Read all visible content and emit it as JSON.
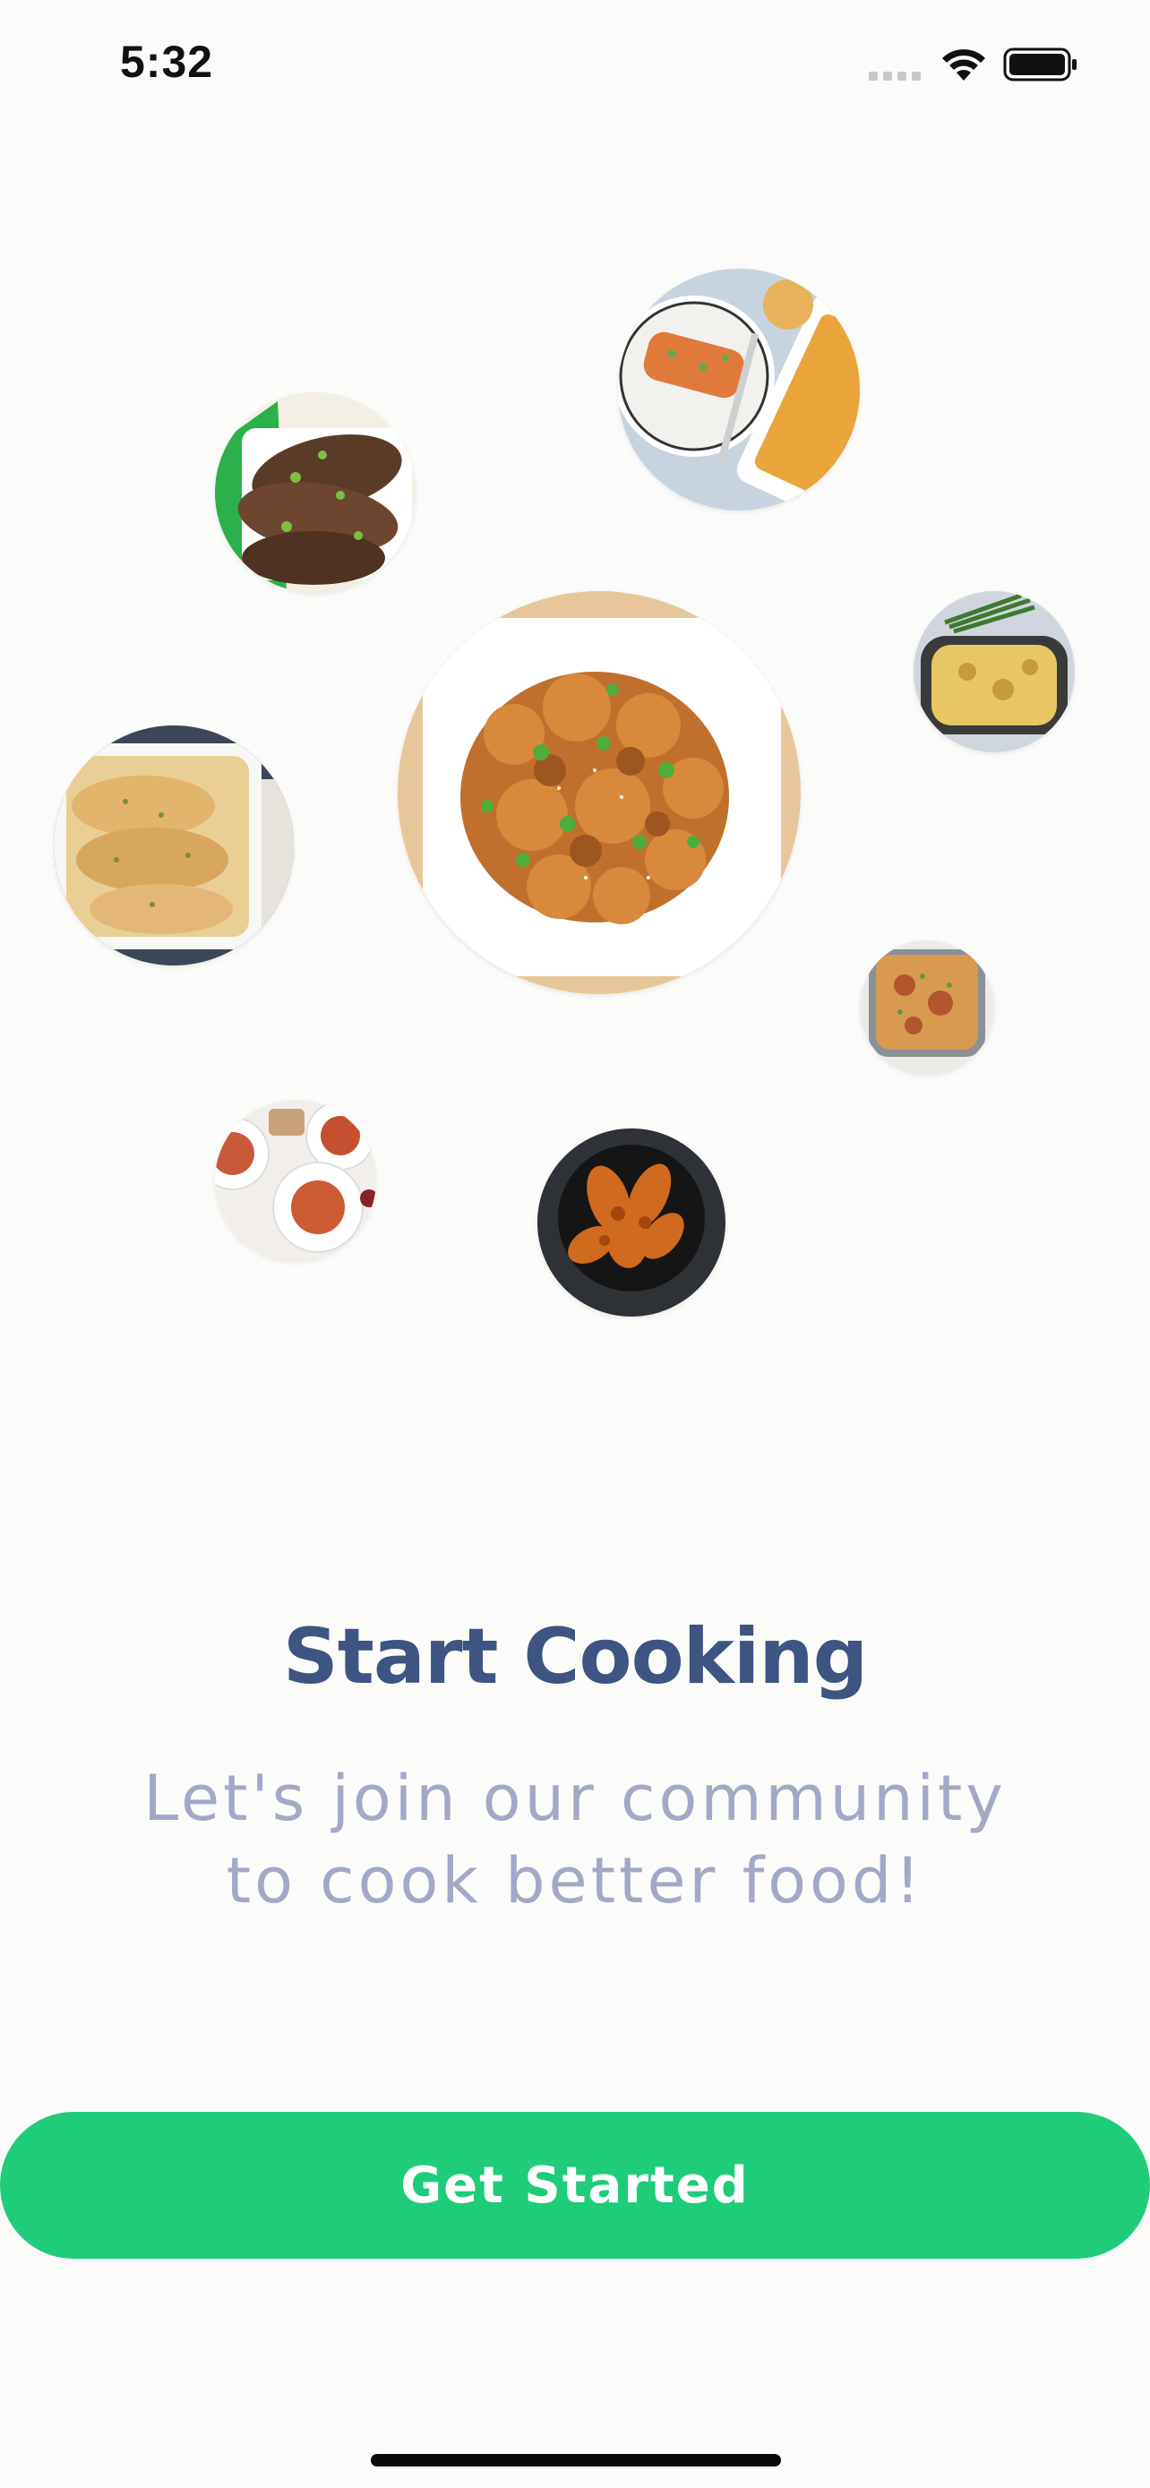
{
  "status_bar": {
    "time": "5:32"
  },
  "onboarding": {
    "title": "Start Cooking",
    "subtitle_line1": "Let's join our community",
    "subtitle_line2": "to cook better food!",
    "cta_label": "Get Started"
  },
  "colors": {
    "accent": "#1fcc79",
    "title": "#3e5483",
    "subtitle": "#a2a8c6",
    "background": "#fbfbf9"
  },
  "food_images": [
    "food-photo-grilled-eggplant",
    "food-photo-enchiladas",
    "food-photo-casserole-green-beans",
    "food-photo-baked-chicken",
    "food-photo-sesame-chicken",
    "food-photo-lasagna",
    "food-photo-plated-pasta",
    "food-photo-chicken-wings"
  ]
}
